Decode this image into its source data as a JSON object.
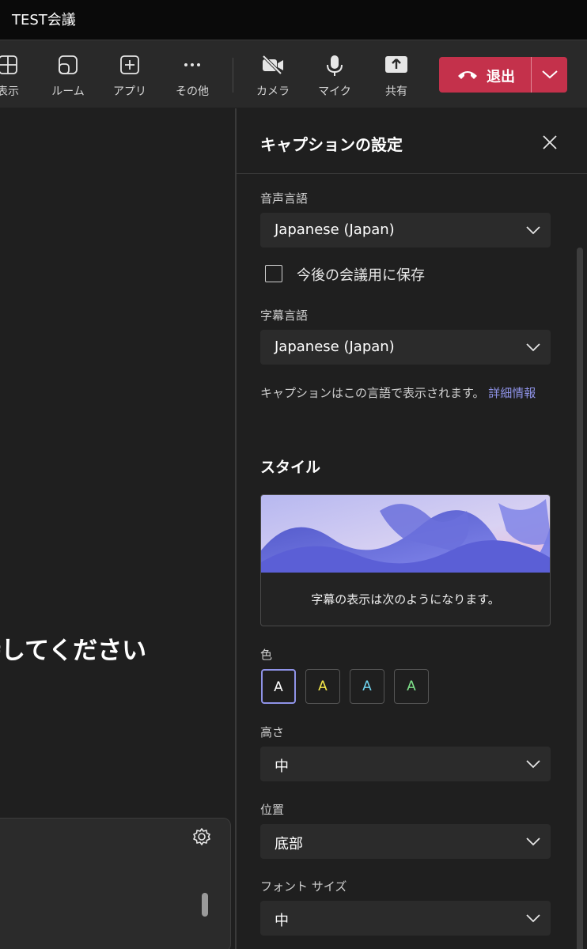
{
  "window": {
    "title": "TEST会議"
  },
  "toolbar": {
    "view_label": "表示",
    "rooms_label": "ルーム",
    "apps_label": "アプリ",
    "more_label": "その他",
    "camera_label": "カメラ",
    "mic_label": "マイク",
    "share_label": "共有",
    "leave_label": "退出",
    "leave_color": "#c4314b"
  },
  "stage": {
    "waiting_text": "持してください"
  },
  "panel": {
    "title": "キャプションの設定",
    "spoken_language_label": "音声言語",
    "spoken_language_value": "Japanese (Japan)",
    "save_checkbox_label": "今後の会議用に保存",
    "save_checked": false,
    "caption_language_label": "字幕言語",
    "caption_language_value": "Japanese (Japan)",
    "note_text": "キャプションはこの言語で表示されます。",
    "note_link": "詳細情報",
    "style_title": "スタイル",
    "preview_text": "字幕の表示は次のようになります。",
    "color_label": "色",
    "colors": [
      {
        "letter": "A",
        "color": "#ffffff",
        "selected": true
      },
      {
        "letter": "A",
        "color": "#f5e84a",
        "selected": false
      },
      {
        "letter": "A",
        "color": "#6fd3ee",
        "selected": false
      },
      {
        "letter": "A",
        "color": "#7ee08a",
        "selected": false
      }
    ],
    "height_label": "高さ",
    "height_value": "中",
    "position_label": "位置",
    "position_value": "底部",
    "font_size_label": "フォント サイズ",
    "font_size_value": "中",
    "accent_color": "#8f93e8"
  }
}
